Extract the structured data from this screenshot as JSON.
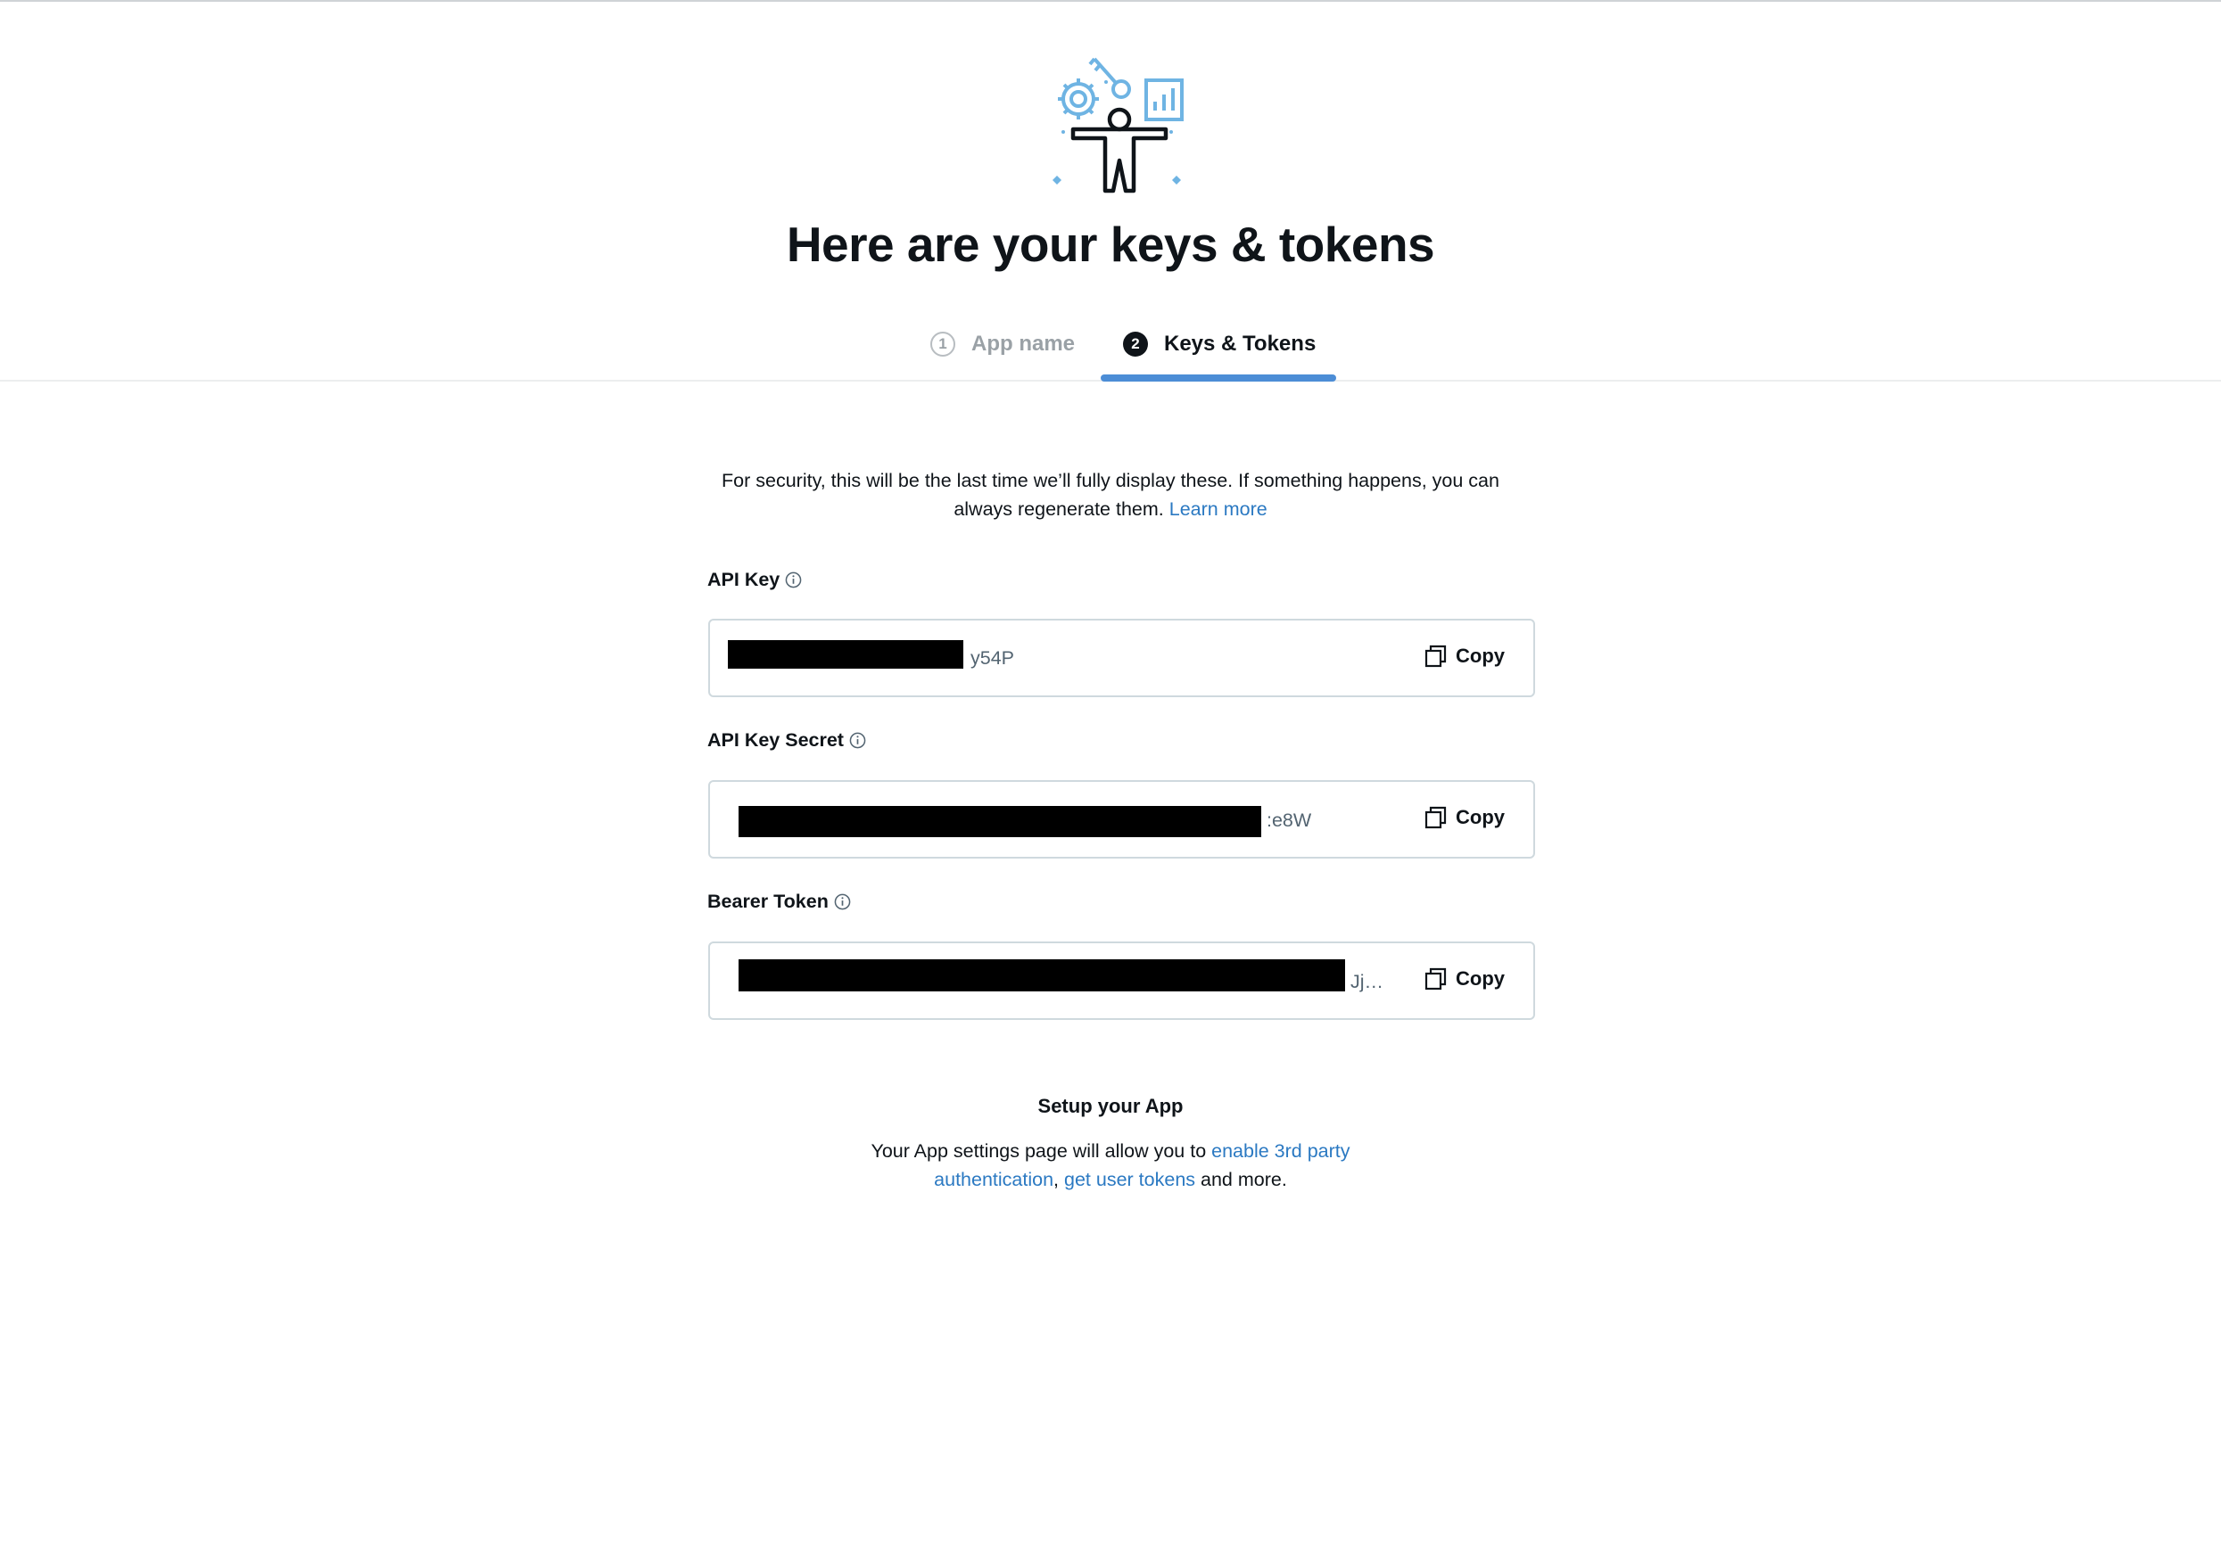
{
  "header": {
    "title": "Here are your keys & tokens",
    "tabs": [
      {
        "number": "1",
        "label": "App name",
        "active": false
      },
      {
        "number": "2",
        "label": "Keys & Tokens",
        "active": true
      }
    ]
  },
  "notice": {
    "text": "For security, this will be the last time we’ll fully display these. If something happens, you can always regenerate them.",
    "link_label": "Learn more"
  },
  "keys": [
    {
      "label": "API Key",
      "visible_suffix": "y54P",
      "copy_label": "Copy"
    },
    {
      "label": "API Key Secret",
      "visible_suffix": ":e8W",
      "copy_label": "Copy"
    },
    {
      "label": "Bearer Token",
      "visible_suffix": "Jj…",
      "copy_label": "Copy"
    }
  ],
  "setup": {
    "title": "Setup your App",
    "text_before": "Your App settings page will allow you to",
    "link_1": "enable 3rd party authentication",
    "separator": ",",
    "link_2": "get user tokens",
    "text_after": "and more."
  },
  "colors": {
    "accent": "#4c8dd6",
    "link": "#2b79c2",
    "illustration": "#6fb4e3",
    "text": "#0f1419"
  },
  "icons": {
    "hero": "developer-illustration-icon",
    "info": "info-icon",
    "copy": "copy-icon"
  }
}
